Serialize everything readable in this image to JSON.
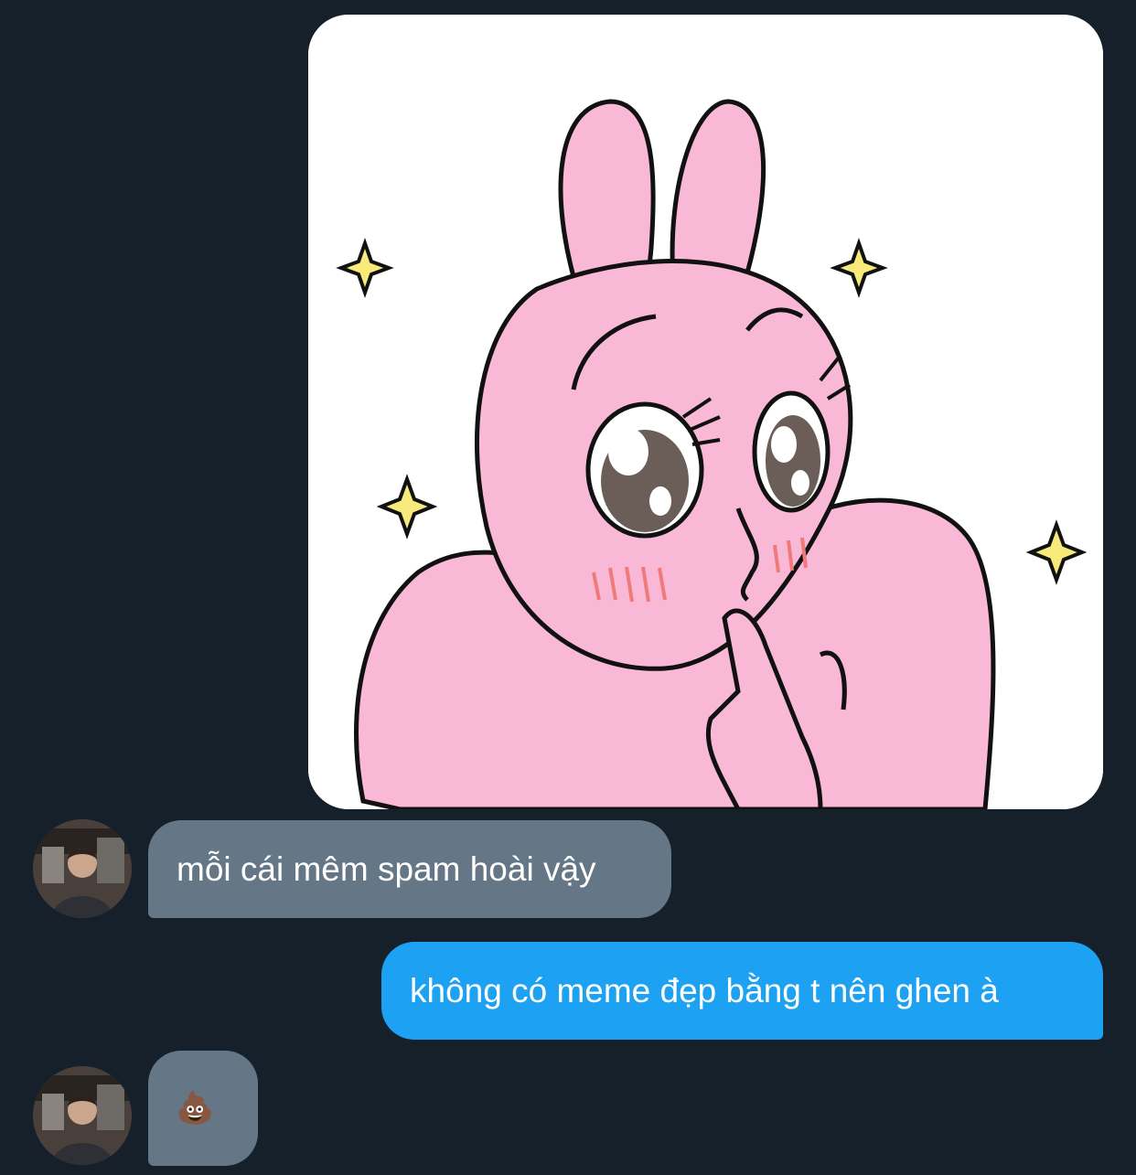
{
  "conversation": {
    "messages": [
      {
        "sender": "self",
        "type": "sticker",
        "sticker": {
          "description": "pink bunny with sparkly eyes, finger on lips"
        }
      },
      {
        "sender": "other",
        "type": "text",
        "text": "mỗi cái mêm spam hoài vậy"
      },
      {
        "sender": "self",
        "type": "text",
        "text": "không có meme đẹp bằng t nên ghen à"
      },
      {
        "sender": "other",
        "type": "emoji",
        "text": "💩",
        "icon": "pile-of-poo-icon"
      }
    ]
  },
  "colors": {
    "background": "#15202b",
    "received_bubble": "#657786",
    "sent_bubble": "#1da1f2",
    "text": "#ffffff"
  }
}
